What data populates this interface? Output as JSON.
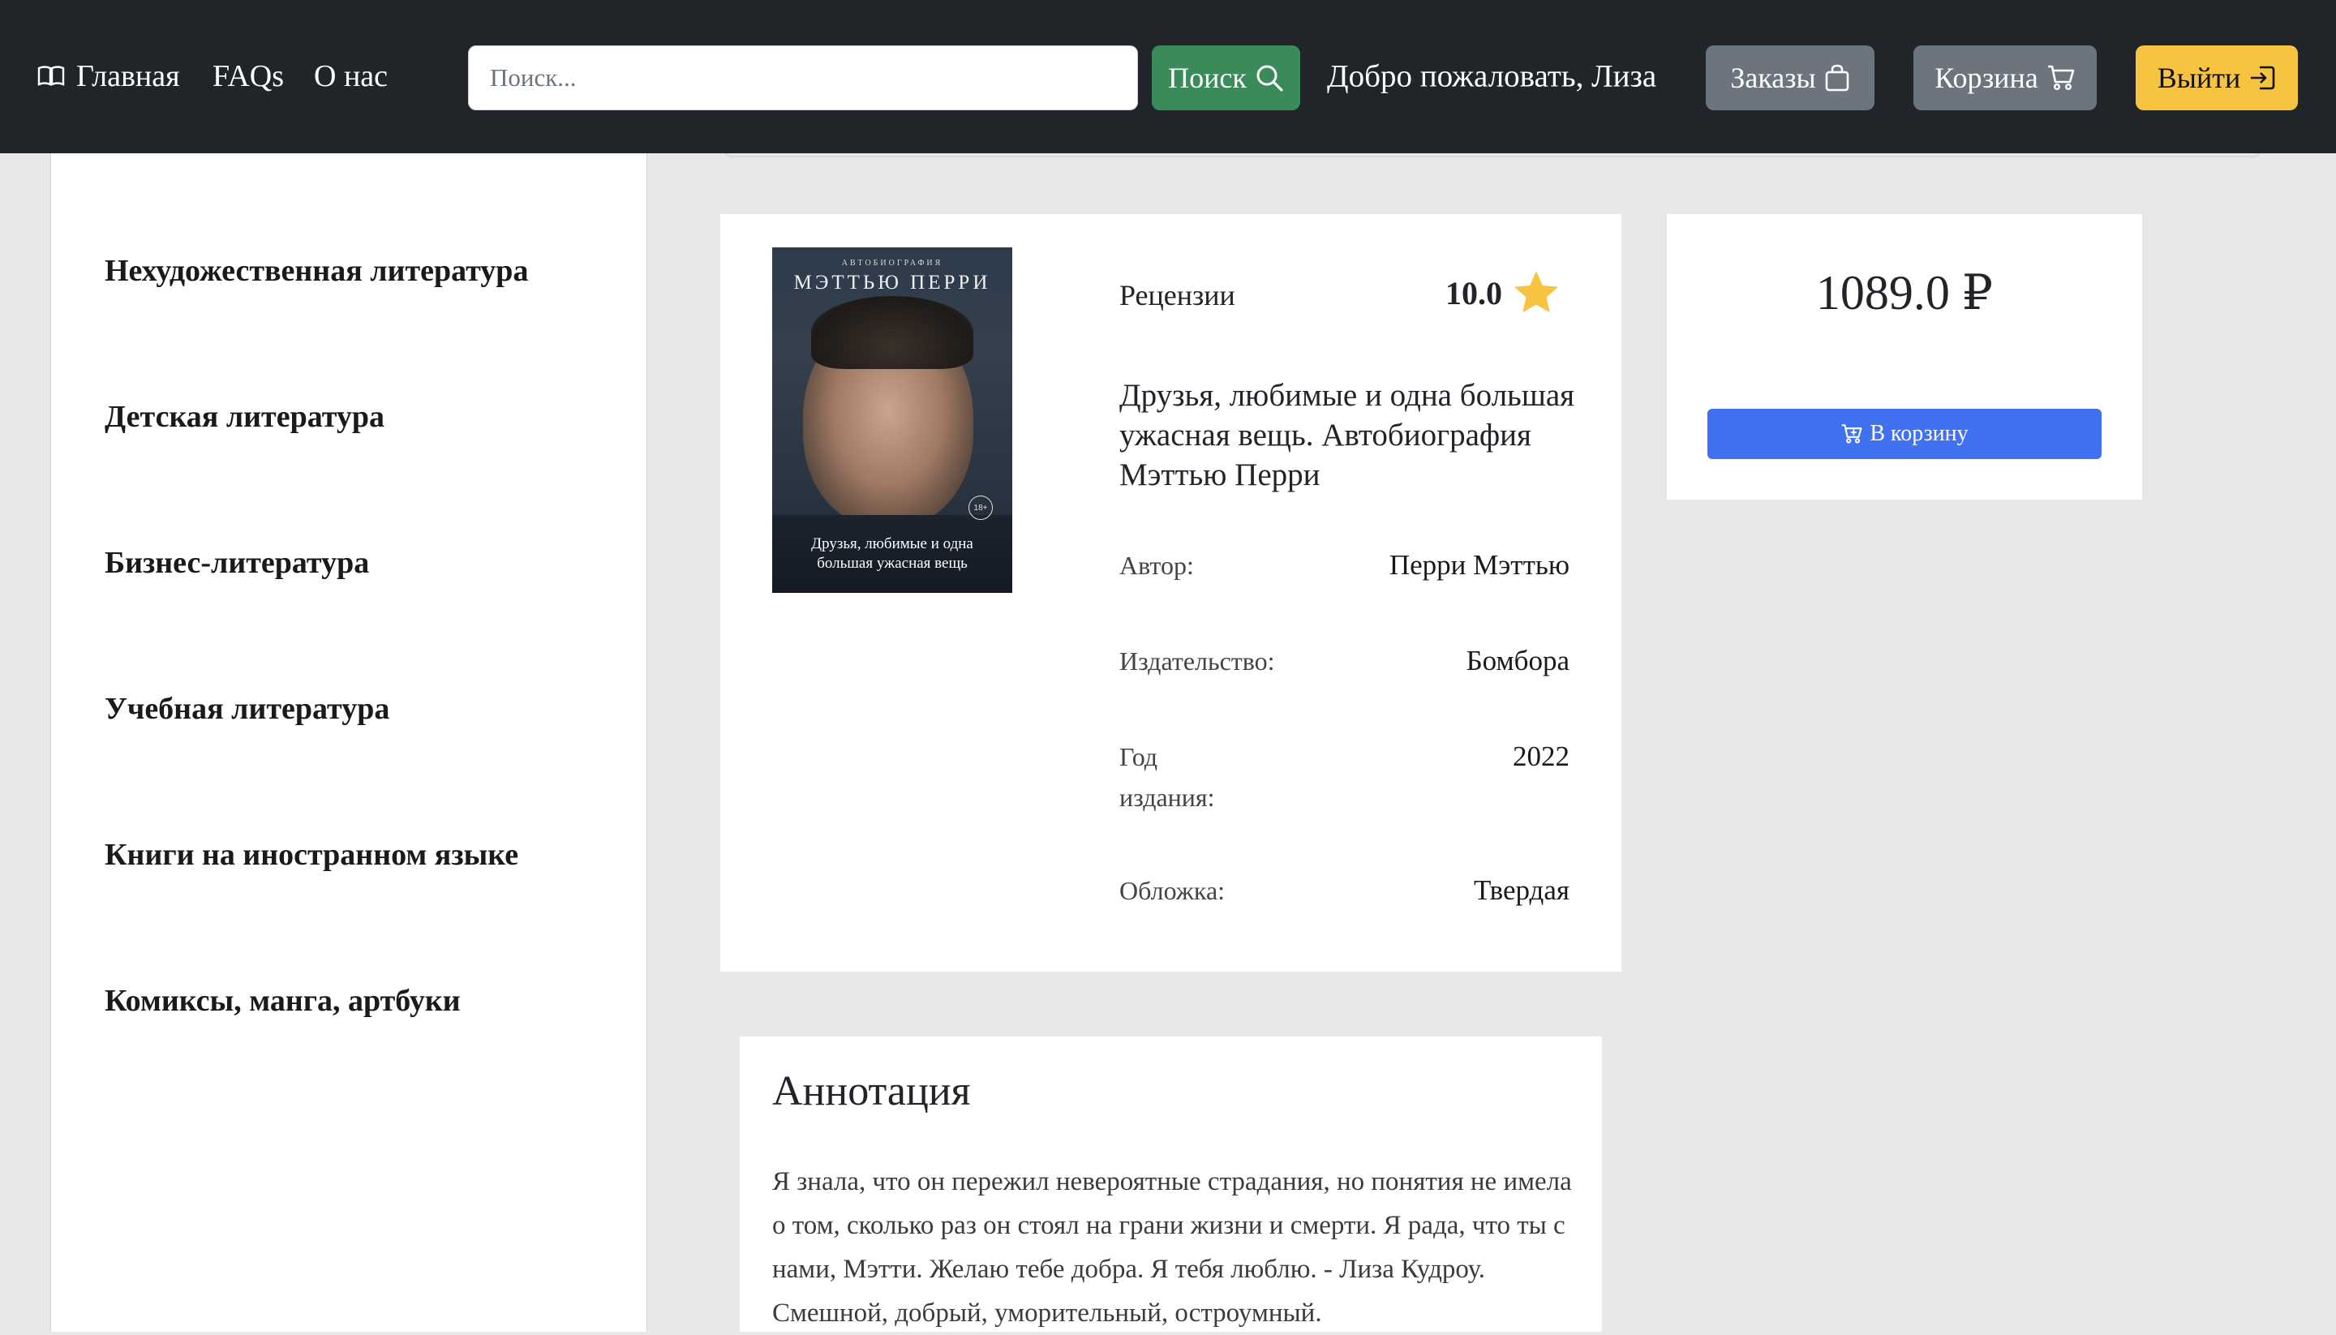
{
  "colors": {
    "navbar_bg": "#212529",
    "search_button": "#3a8a5a",
    "secondary_button": "#6c757d",
    "logout_button": "#f6c441",
    "primary_button": "#3f71f0",
    "star": "#f6c441"
  },
  "nav": {
    "home_icon": "book-icon",
    "home": "Главная",
    "faqs": "FAQs",
    "about": "О нас",
    "search_placeholder": "Поиск...",
    "search_button": "Поиск",
    "welcome": "Добро пожаловать, Лиза",
    "orders": "Заказы",
    "orders_icon": "bag-icon",
    "cart": "Корзина",
    "cart_icon": "cart-icon",
    "logout": "Выйти",
    "logout_icon": "logout-icon"
  },
  "sidebar": {
    "categories": [
      "Нехудожественная литература",
      "Детская литература",
      "Бизнес-литература",
      "Учебная литература",
      "Книги на иностранном языке",
      "Комиксы, манга, артбуки"
    ]
  },
  "product": {
    "cover": {
      "top_small": "АВТОБИОГРАФИЯ",
      "top_name": "МЭТТЬЮ ПЕРРИ",
      "bottom_line1": "Друзья, любимые и одна",
      "bottom_line2": "большая ужасная вещь",
      "age": "18+"
    },
    "reviews_label": "Рецензии",
    "rating": "10.0",
    "title": "Друзья, любимые и одна большая ужасная вещь. Автобиография Мэттью Перри",
    "specs": {
      "author_label": "Автор:",
      "author": "Перри Мэттью",
      "publisher_label": "Издательство:",
      "publisher": "Бомбора",
      "year_label": "Год издания:",
      "year": "2022",
      "cover_label": "Обложка:",
      "cover_type": "Твердая"
    }
  },
  "purchase": {
    "price": "1089.0 ₽",
    "add_to_cart": "В корзину"
  },
  "annotation": {
    "title": "Аннотация",
    "text": "Я знала, что он пережил невероятные страдания, но понятия не имела о том, сколько раз он стоял на грани жизни и смерти. Я рада, что ты с нами, Мэтти. Желаю тебе добра. Я тебя люблю. - Лиза Кудроу. Смешной, добрый, уморительный, остроумный."
  }
}
